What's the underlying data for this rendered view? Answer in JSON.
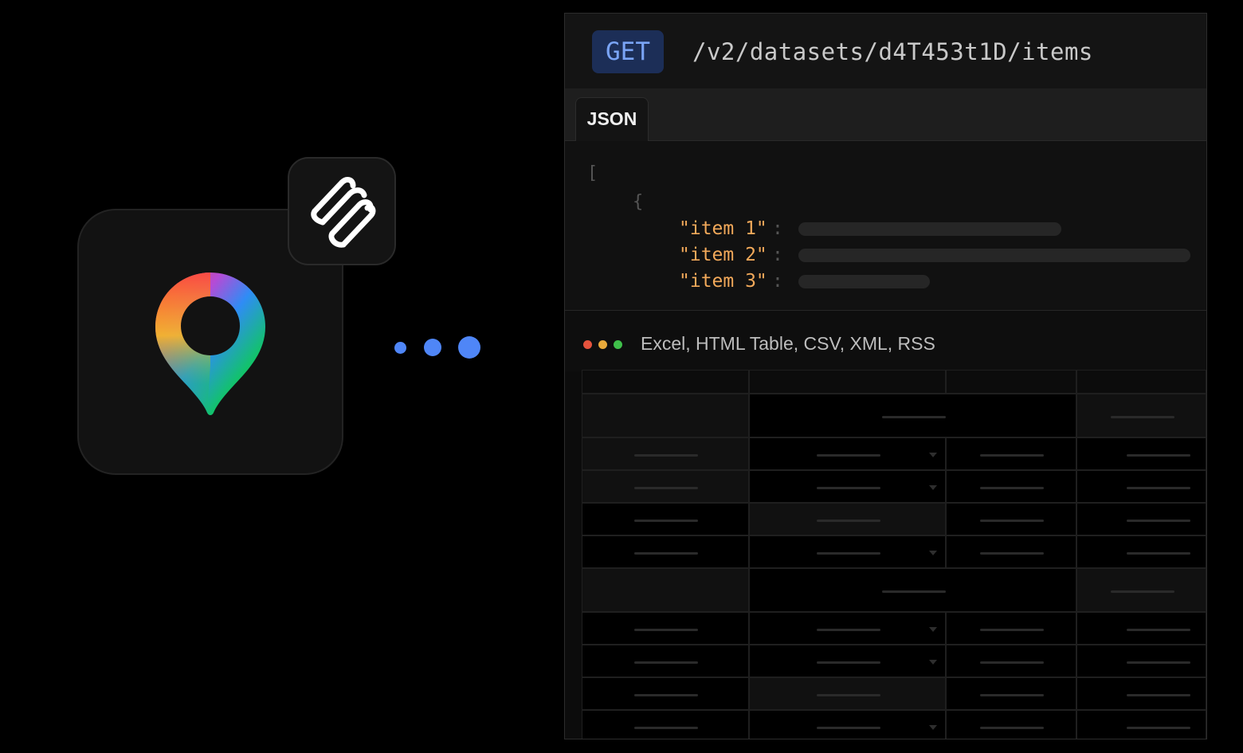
{
  "request": {
    "method": "GET",
    "endpoint": "/v2/datasets/d4T453t1D/items"
  },
  "tabs": [
    {
      "label": "JSON",
      "active": true
    }
  ],
  "json_preview": {
    "open_bracket": "[",
    "open_brace": "{",
    "items": [
      {
        "key": "\"item 1\"",
        "colon": ":"
      },
      {
        "key": "\"item 2\"",
        "colon": ":"
      },
      {
        "key": "\"item 3\"",
        "colon": ":"
      }
    ]
  },
  "export": {
    "formats": "Excel, HTML Table, CSV, XML, RSS",
    "window_dots": [
      "#e5533d",
      "#e8a93a",
      "#3fbf4a"
    ]
  },
  "icons": {
    "app": "map-pin-icon",
    "badge": "apify-logo-icon",
    "connector": "ellipsis-dots-icon"
  },
  "colors": {
    "accent_blue": "#4f86f7",
    "get_badge_bg": "#1c2e57",
    "get_badge_text": "#7aa4f5",
    "json_key": "#f2a95a"
  }
}
